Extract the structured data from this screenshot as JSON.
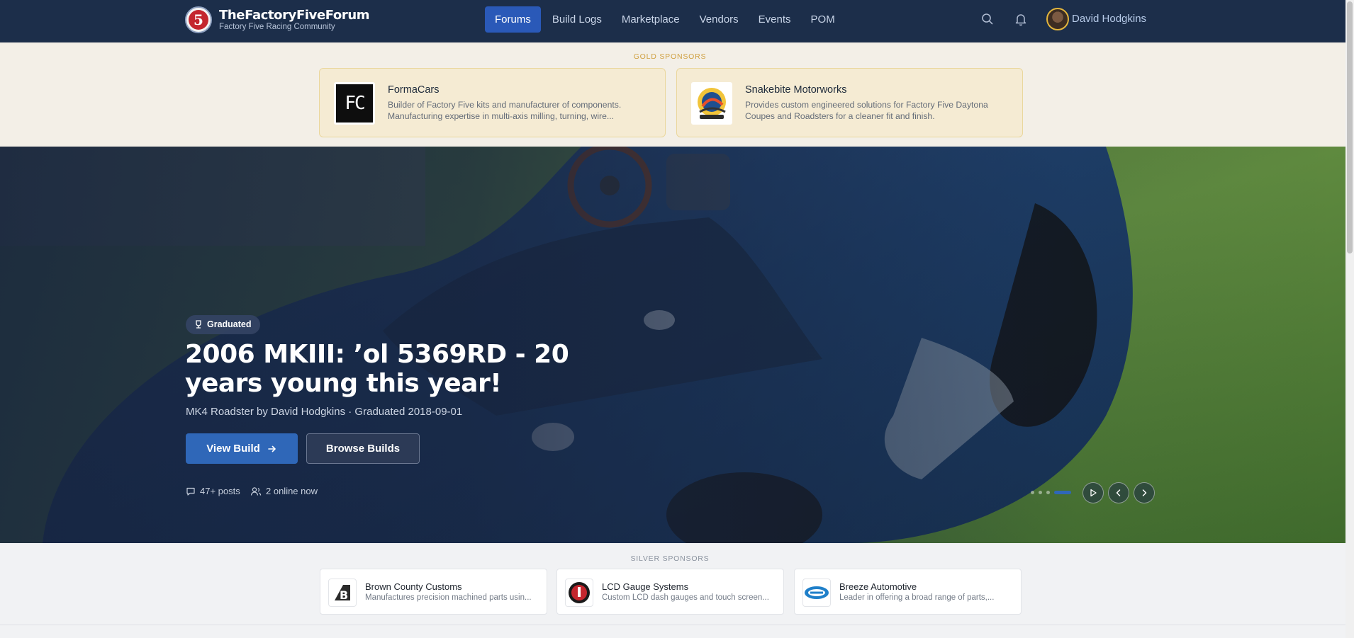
{
  "header": {
    "logo_glyph": "5",
    "site_title": "TheFactoryFiveForum",
    "site_subtitle": "Factory Five Racing Community",
    "nav": [
      {
        "label": "Forums",
        "active": true
      },
      {
        "label": "Build Logs",
        "active": false
      },
      {
        "label": "Marketplace",
        "active": false
      },
      {
        "label": "Vendors",
        "active": false
      },
      {
        "label": "Events",
        "active": false
      },
      {
        "label": "POM",
        "active": false
      }
    ],
    "icons": [
      "search-icon",
      "bell-icon"
    ],
    "user_name": "David Hodgkins"
  },
  "gold_sponsors": {
    "label": "GOLD SPONSORS",
    "items": [
      {
        "name": "FormaCars",
        "logo_text": "FC",
        "description": "Builder of Factory Five kits and manufacturer of components. Manufacturing expertise in multi-axis milling, turning, wire..."
      },
      {
        "name": "Snakebite Motorworks",
        "description": "Provides custom engineered solutions for Factory Five Daytona Coupes and Roadsters for a cleaner fit and finish."
      }
    ]
  },
  "hero": {
    "badge": "Graduated",
    "title": "2006 MKIII: ’ol 5369RD - 20 years young this year!",
    "meta": "MK4 Roadster by David Hodgkins · Graduated 2018-09-01",
    "primary_button": "View Build",
    "secondary_button": "Browse Builds",
    "stats": {
      "posts": "47+ posts",
      "online": "2 online now"
    },
    "slides_count": 4,
    "active_slide": 4
  },
  "silver_sponsors": {
    "label": "SILVER SPONSORS",
    "items": [
      {
        "name": "Brown County Customs",
        "description": "Manufactures precision machined parts usin..."
      },
      {
        "name": "LCD Gauge Systems",
        "description": "Custom LCD dash gauges and touch screen..."
      },
      {
        "name": "Breeze Automotive",
        "description": "Leader in offering a broad range of parts,..."
      }
    ]
  },
  "colors": {
    "header_bg": "#1c2e4a",
    "accent_blue": "#2f67b8",
    "gold": "#cfa040",
    "gold_card_bg": "#f5ebd3"
  }
}
